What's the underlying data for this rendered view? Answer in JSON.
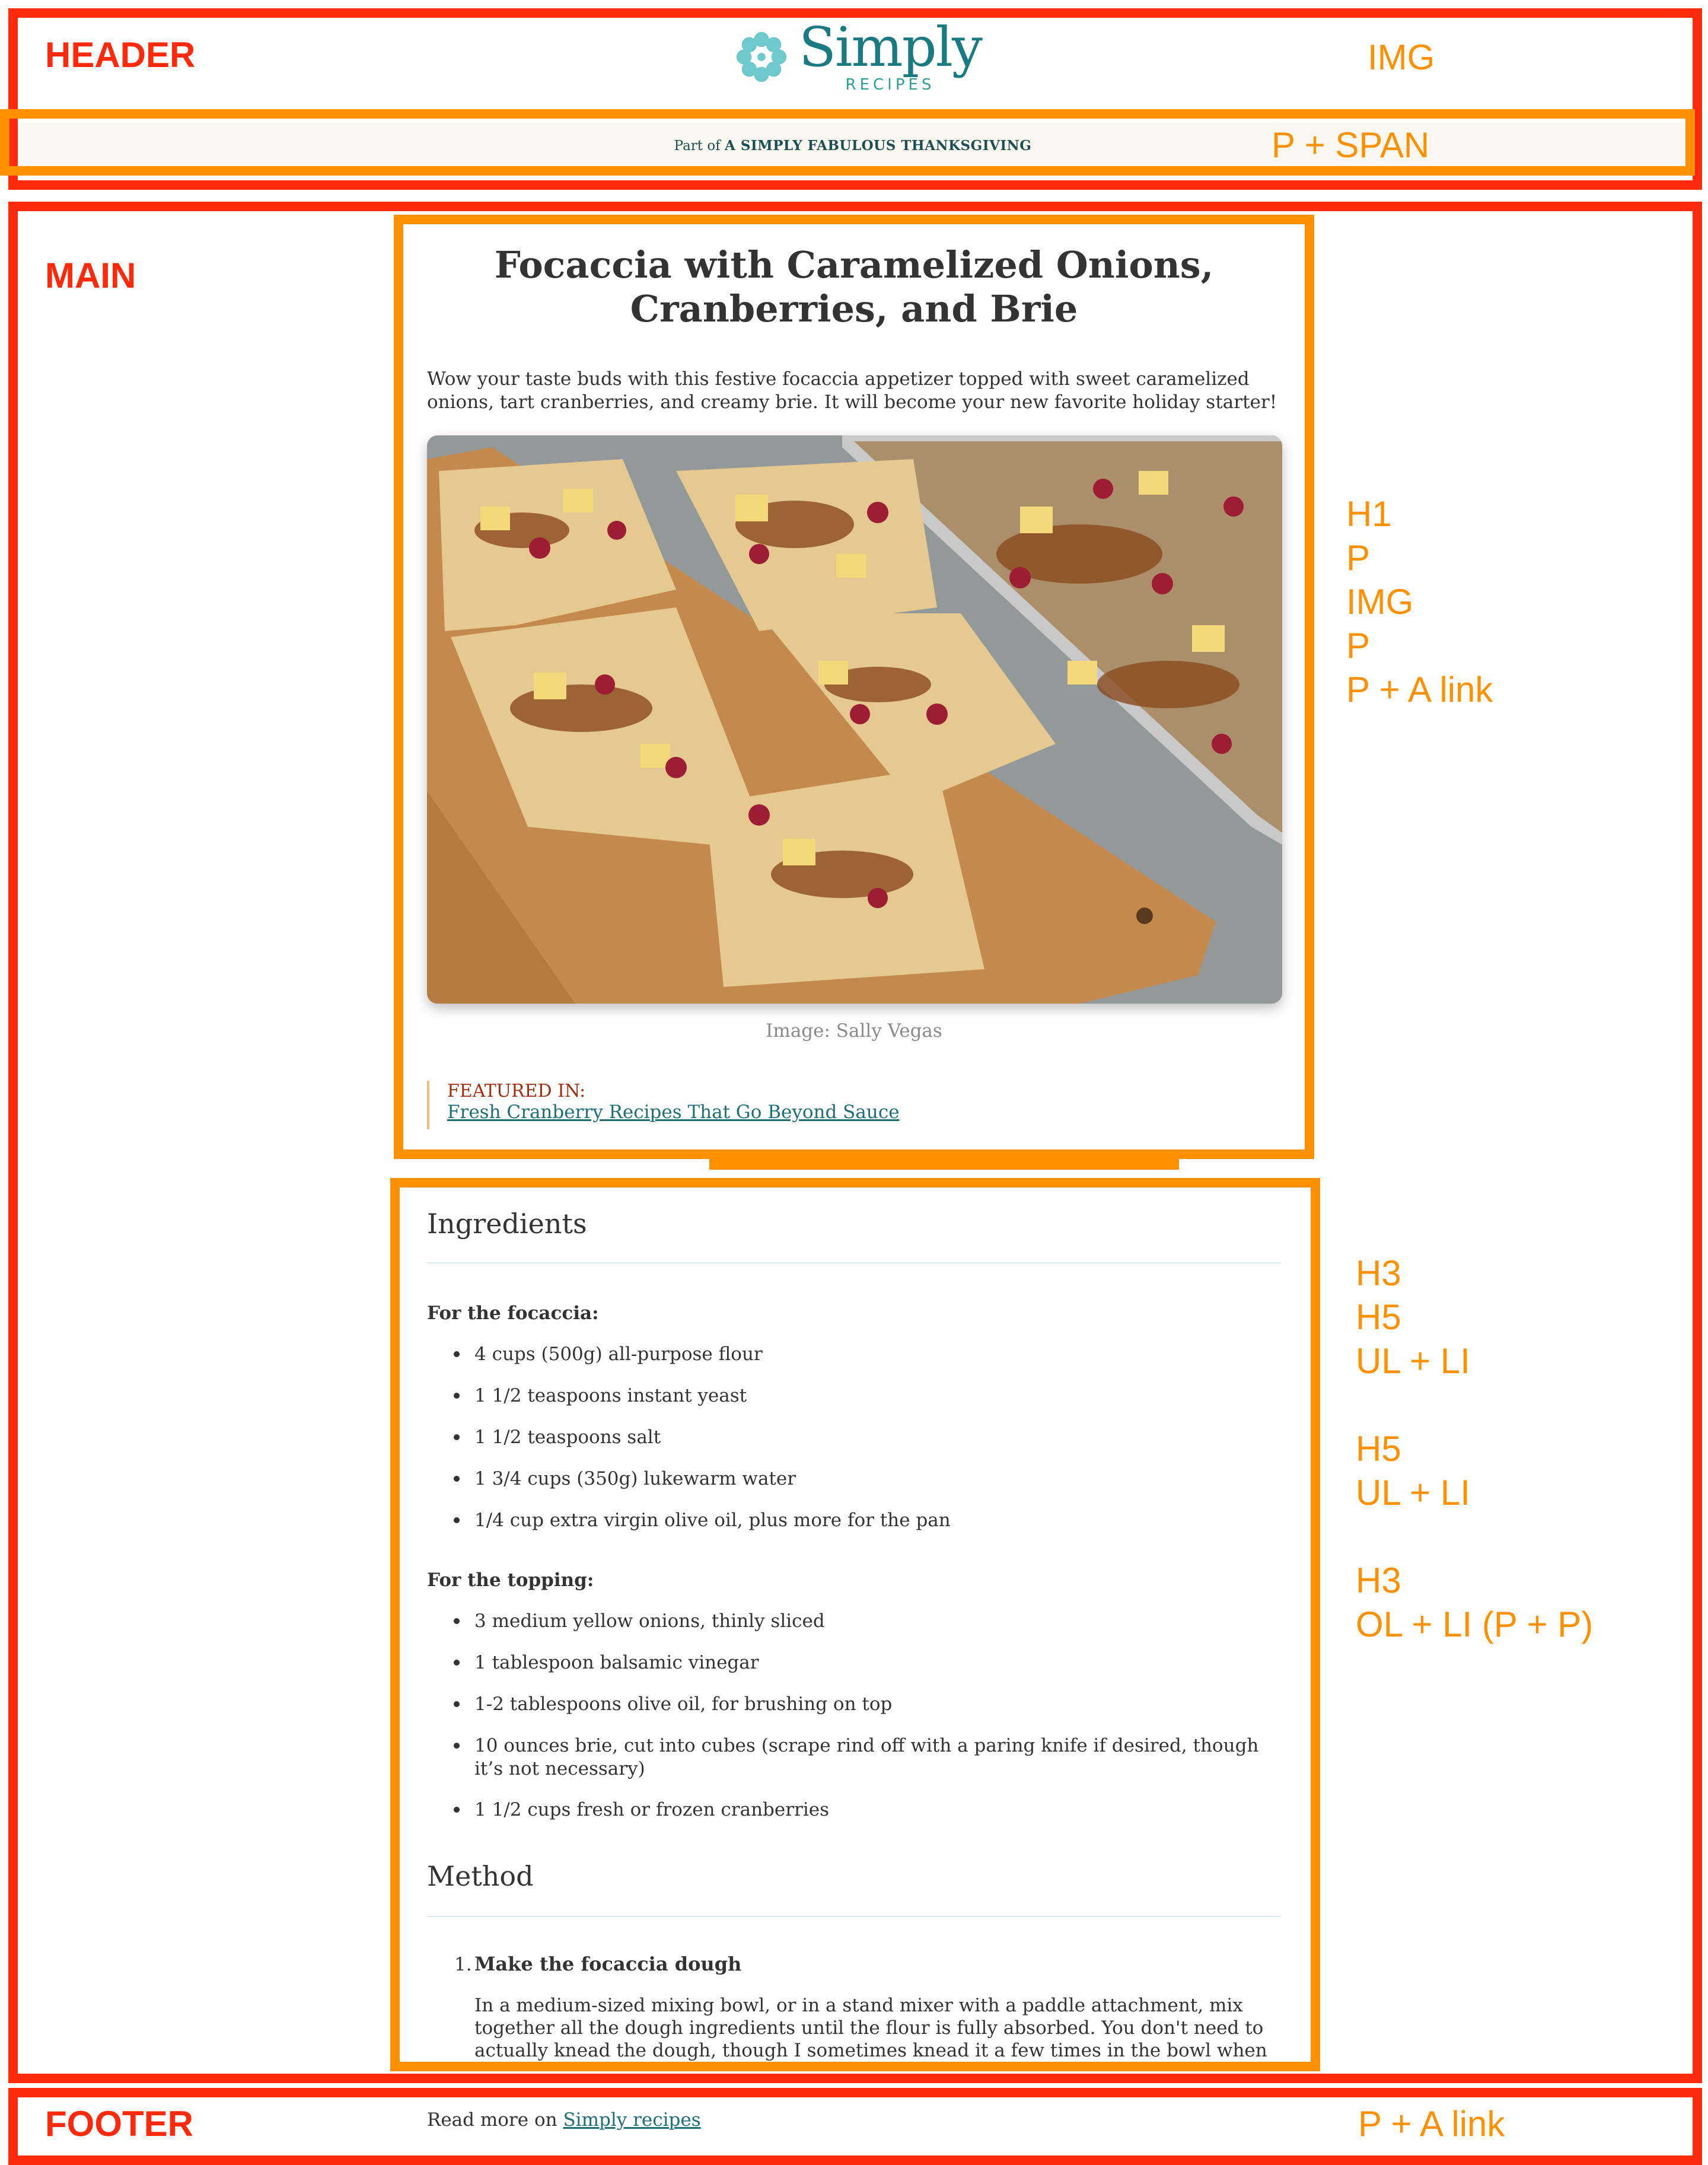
{
  "labels": {
    "header": "HEADER",
    "main": "MAIN",
    "footer": "FOOTER",
    "header_img": "IMG",
    "header_banner": "P + SPAN",
    "article_tags": "H1\nP\nIMG\nP\nP + A link",
    "ingredients_tags": "H3\nH5\nUL + LI\n\nH5\nUL + LI\n\nH3\nOL + LI (P + P)",
    "footer_tags": "P + A link"
  },
  "logo": {
    "name": "Simply",
    "sub": "RECIPES"
  },
  "banner": {
    "prefix": "Part of",
    "title": "A SIMPLY FABULOUS THANKSGIVING"
  },
  "article": {
    "title_line1": "Focaccia with Caramelized Onions,",
    "title_line2": "Cranberries, and Brie",
    "intro": "Wow your taste buds with this festive focaccia appetizer topped with sweet caramelized onions, tart cranberries, and creamy brie. It will become your new favorite holiday starter!",
    "caption": "Image: Sally Vegas",
    "featured_label": "FEATURED IN:",
    "featured_link": "Fresh Cranberry Recipes That Go Beyond Sauce"
  },
  "ingredients": {
    "heading": "Ingredients",
    "focaccia_heading": "For the focaccia:",
    "focaccia": [
      "4 cups (500g) all-purpose flour",
      "1 1/2 teaspoons instant yeast",
      "1 1/2 teaspoons salt",
      "1 3/4 cups (350g) lukewarm water",
      "1/4 cup extra virgin olive oil, plus more for the pan"
    ],
    "topping_heading": "For the topping:",
    "topping": [
      "3 medium yellow onions, thinly sliced",
      "1 tablespoon balsamic vinegar",
      "1-2 tablespoons olive oil, for brushing on top",
      "10 ounces brie, cut into cubes (scrape rind off with a paring knife if desired, though it’s not necessary)",
      "1 1/2 cups fresh or frozen cranberries"
    ]
  },
  "method": {
    "heading": "Method",
    "step1_num": "1.",
    "step1_title": "Make the focaccia dough",
    "step1_text": "In a medium-sized mixing bowl, or in a stand mixer with a paddle attachment, mix together all the dough ingredients until the flour is fully absorbed. You don't need to actually knead the dough, though I sometimes knead it a few times in the bowl when mixing by hand to incorporate the last of the flour."
  },
  "footer": {
    "text": "Read more on",
    "link": "Simply recipes"
  },
  "colors": {
    "overlay_red": "#ff2a0b",
    "overlay_orange": "#ff9000",
    "brand_teal": "#1a7a82",
    "link": "#1f6f74"
  }
}
